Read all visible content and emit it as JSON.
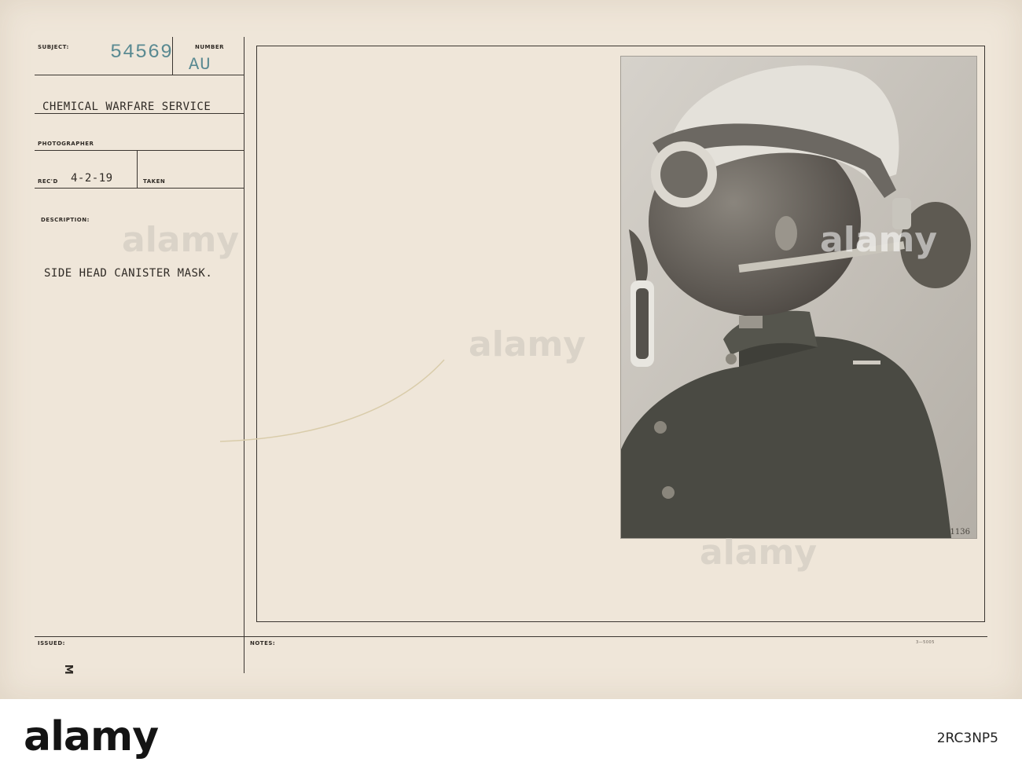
{
  "card": {
    "subject_label": "SUBJECT:",
    "subject_number": "54569",
    "number_label": "NUMBER",
    "number_value": "AU",
    "service": "CHEMICAL WARFARE SERVICE",
    "photographer_label": "PHOTOGRAPHER",
    "recd_label": "REC'D",
    "recd_date": "4-2-19",
    "taken_label": "TAKEN",
    "description_label": "DESCRIPTION:",
    "description": "SIDE HEAD CANISTER MASK.",
    "issued_label": "ISSUED:",
    "notes_label": "NOTES:",
    "form_code": "3—5005",
    "side_mark": "M"
  },
  "photo": {
    "corner_number": "1136",
    "alt_subject": "soldier wearing side head canister gas mask"
  },
  "watermark": {
    "text": "alamy",
    "footer_id": "2RC3NP5"
  },
  "colors": {
    "card": "#efe6d9",
    "ink": "#2f2a25",
    "stamp": "#5a8a92"
  }
}
